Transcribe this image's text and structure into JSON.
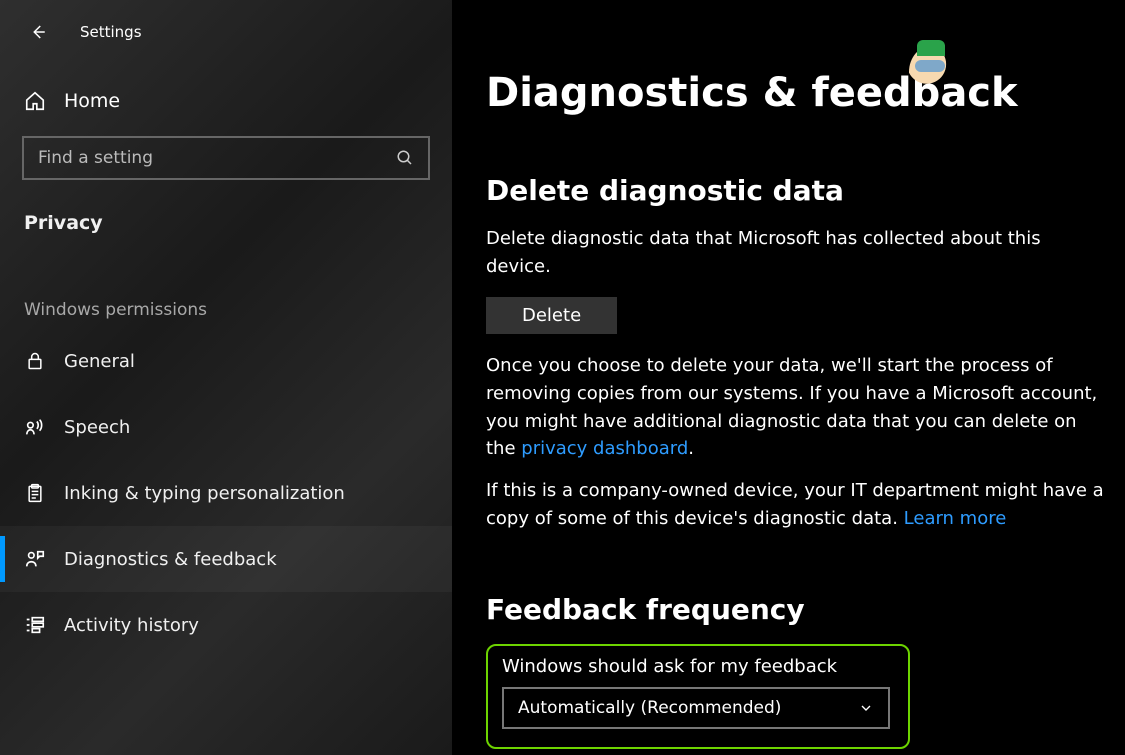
{
  "titlebar": {
    "app_name": "Settings"
  },
  "sidebar": {
    "home_label": "Home",
    "search_placeholder": "Find a setting",
    "section_label": "Privacy",
    "group_label": "Windows permissions",
    "items": [
      {
        "label": "General"
      },
      {
        "label": "Speech"
      },
      {
        "label": "Inking & typing personalization"
      },
      {
        "label": "Diagnostics & feedback"
      },
      {
        "label": "Activity history"
      }
    ]
  },
  "main": {
    "title": "Diagnostics & feedback",
    "delete_section": {
      "heading": "Delete diagnostic data",
      "desc": "Delete diagnostic data that Microsoft has collected about this device.",
      "button_label": "Delete",
      "para_pre": "Once you choose to delete your data, we'll start the process of removing copies from our systems. If you have a Microsoft account, you might have additional diagnostic data that you can delete on the ",
      "para_link": "privacy dashboard",
      "para_post": ".",
      "para2_pre": "If this is a company-owned device, your IT department might have a copy of some of this device's diagnostic data. ",
      "para2_link": "Learn more"
    },
    "feedback_section": {
      "heading": "Feedback frequency",
      "dropdown_label": "Windows should ask for my feedback",
      "dropdown_value": "Automatically (Recommended)"
    }
  }
}
